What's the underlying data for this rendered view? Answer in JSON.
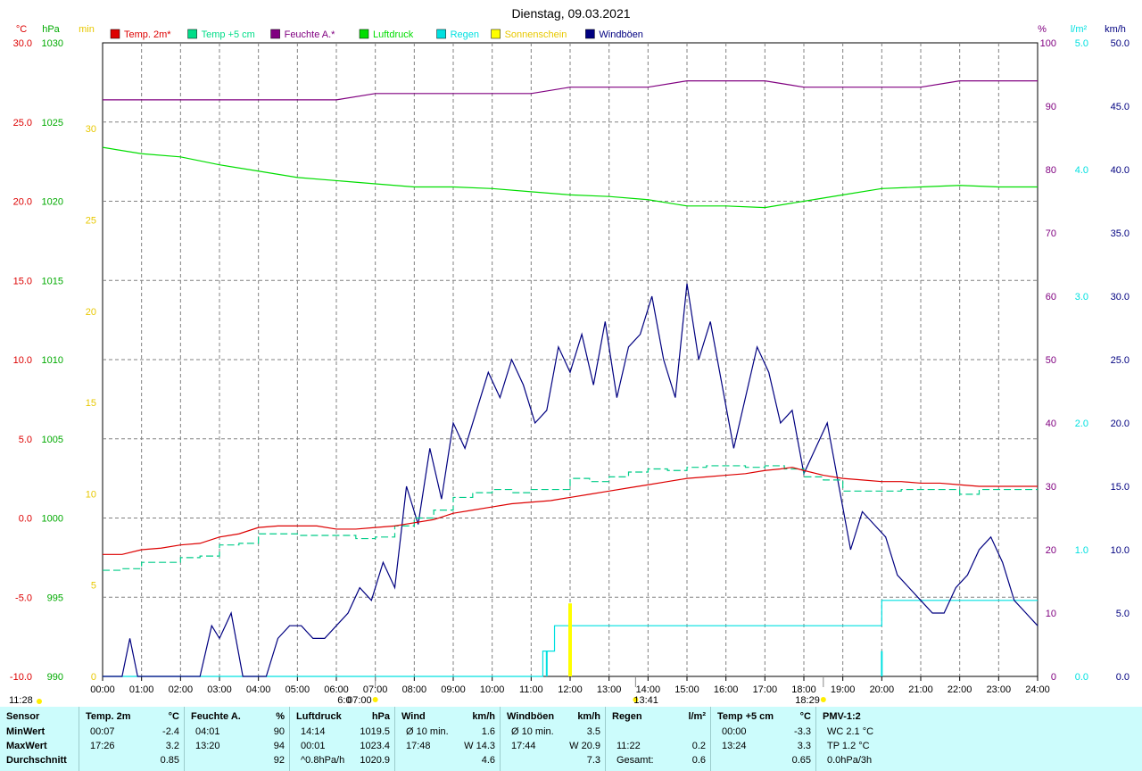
{
  "title": "Dienstag, 09.03.2021",
  "colors": {
    "temp2m": "#dd0000",
    "temp5cm": "#00cc88",
    "humidity": "#800080",
    "pressure": "#00dd00",
    "rain": "#00e0e0",
    "sunshine": "#ffff00",
    "wind": "#000080",
    "grid": "#808080",
    "stats_bg": "#ccfcfc"
  },
  "legend": [
    {
      "label": "Temp. 2m*",
      "color": "#dd0000"
    },
    {
      "label": "Temp +5 cm",
      "color": "#00dd88"
    },
    {
      "label": "Feuchte A.*",
      "color": "#800080"
    },
    {
      "label": "Luftdruck",
      "color": "#00dd00"
    },
    {
      "label": "Regen",
      "color": "#00e0e0"
    },
    {
      "label": "Sonnenschein",
      "color": "#ffff00"
    },
    {
      "label": "Windböen",
      "color": "#000080"
    }
  ],
  "axis_units": {
    "temp": "°C",
    "pressure": "hPa",
    "sun": "min",
    "humidity": "%",
    "rain": "l/m²",
    "wind": "km/h"
  },
  "chart_data": {
    "type": "line",
    "title": "Dienstag, 09.03.2021",
    "x_ticks": [
      "00:00",
      "01:00",
      "02:00",
      "03:00",
      "04:00",
      "05:00",
      "06:00",
      "07:00",
      "08:00",
      "09:00",
      "10:00",
      "11:00",
      "12:00",
      "13:00",
      "14:00",
      "15:00",
      "16:00",
      "17:00",
      "18:00",
      "19:00",
      "20:00",
      "21:00",
      "22:00",
      "23:00",
      "24:00"
    ],
    "axes": {
      "temp": {
        "label": "°C",
        "range": [
          -10,
          30
        ],
        "ticks": [
          "30.0",
          "25.0",
          "20.0",
          "15.0",
          "10.0",
          "5.0",
          "0.0",
          "-5.0",
          "-10.0"
        ]
      },
      "pressure": {
        "label": "hPa",
        "range": [
          990,
          1030
        ],
        "ticks": [
          "1030",
          "1025",
          "1020",
          "1015",
          "1010",
          "1005",
          "1000",
          "995",
          "990"
        ]
      },
      "sunshine": {
        "label": "min",
        "range": [
          0,
          30
        ],
        "ticks": [
          "30",
          "25",
          "20",
          "15",
          "10",
          "5",
          "0"
        ]
      },
      "humidity": {
        "label": "%",
        "range": [
          0,
          100
        ],
        "ticks": [
          "100",
          "90",
          "80",
          "70",
          "60",
          "50",
          "40",
          "30",
          "20",
          "10",
          "0"
        ]
      },
      "rain": {
        "label": "l/m²",
        "range": [
          0,
          5
        ],
        "ticks": [
          "5.0",
          "4.0",
          "3.0",
          "2.0",
          "1.0",
          "0.0"
        ]
      },
      "wind": {
        "label": "km/h",
        "range": [
          0,
          50
        ],
        "ticks": [
          "50.0",
          "45.0",
          "40.0",
          "35.0",
          "30.0",
          "25.0",
          "20.0",
          "15.0",
          "10.0",
          "5.0",
          "0.0"
        ]
      }
    },
    "series": [
      {
        "name": "Temp. 2m*",
        "axis": "temp",
        "x": [
          0,
          0.5,
          1,
          1.5,
          2,
          2.5,
          3,
          3.5,
          4,
          4.5,
          5,
          5.5,
          6,
          6.5,
          7,
          7.5,
          8,
          8.5,
          9,
          9.5,
          10,
          10.5,
          11,
          11.5,
          12,
          12.5,
          13,
          13.5,
          14,
          14.5,
          15,
          15.5,
          16,
          16.5,
          17,
          17.4,
          17.7,
          18,
          18.5,
          19,
          19.5,
          20,
          20.5,
          21,
          21.5,
          22,
          22.5,
          23,
          23.5,
          24
        ],
        "y": [
          -2.3,
          -2.3,
          -2.0,
          -1.9,
          -1.7,
          -1.6,
          -1.2,
          -1.0,
          -0.6,
          -0.5,
          -0.5,
          -0.5,
          -0.7,
          -0.7,
          -0.6,
          -0.5,
          -0.3,
          -0.1,
          0.3,
          0.5,
          0.7,
          0.9,
          1.0,
          1.1,
          1.3,
          1.5,
          1.7,
          1.9,
          2.1,
          2.3,
          2.5,
          2.6,
          2.7,
          2.8,
          3.0,
          3.1,
          3.2,
          3.0,
          2.7,
          2.5,
          2.4,
          2.3,
          2.3,
          2.2,
          2.2,
          2.1,
          2.0,
          2.0,
          2.0,
          2.0
        ]
      },
      {
        "name": "Temp +5 cm",
        "axis": "temp",
        "x": [
          0,
          0.5,
          1,
          1.5,
          2,
          2.5,
          3,
          3.5,
          4,
          4.5,
          5,
          5.5,
          6,
          6.5,
          7,
          7.5,
          8,
          8.5,
          9,
          9.5,
          10,
          10.5,
          11,
          11.5,
          12,
          12.5,
          13,
          13.5,
          14,
          14.5,
          15,
          15.5,
          16,
          16.5,
          17,
          17.5,
          18,
          18.5,
          19,
          19.5,
          20,
          20.5,
          21,
          21.5,
          22,
          22.5,
          23,
          23.5,
          24
        ],
        "y": [
          -3.3,
          -3.2,
          -2.8,
          -2.8,
          -2.5,
          -2.4,
          -1.7,
          -1.6,
          -1.0,
          -1.0,
          -1.1,
          -1.1,
          -1.1,
          -1.3,
          -1.2,
          -0.5,
          0.0,
          0.5,
          1.3,
          1.6,
          1.8,
          1.6,
          1.8,
          1.8,
          2.5,
          2.3,
          2.6,
          2.9,
          3.1,
          3.0,
          3.2,
          3.3,
          3.3,
          3.2,
          3.3,
          3.1,
          2.6,
          2.4,
          1.7,
          1.7,
          1.7,
          1.8,
          1.8,
          1.8,
          1.5,
          1.8,
          1.8,
          1.8,
          1.8
        ]
      },
      {
        "name": "Feuchte A.*",
        "axis": "humidity",
        "x": [
          0,
          1,
          2,
          3,
          4,
          5,
          6,
          7,
          8,
          9,
          10,
          11,
          12,
          13,
          14,
          15,
          16,
          17,
          18,
          19,
          20,
          21,
          22,
          23,
          24
        ],
        "y": [
          91,
          91,
          91,
          91,
          91,
          91,
          91,
          92,
          92,
          92,
          92,
          92,
          93,
          93,
          93,
          94,
          94,
          94,
          93,
          93,
          93,
          93,
          94,
          94,
          94
        ]
      },
      {
        "name": "Luftdruck",
        "axis": "pressure",
        "x": [
          0,
          1,
          2,
          3,
          4,
          5,
          6,
          7,
          8,
          9,
          10,
          11,
          12,
          13,
          14,
          15,
          16,
          17,
          18,
          19,
          20,
          21,
          22,
          23,
          24
        ],
        "y": [
          1023.4,
          1023.0,
          1022.8,
          1022.3,
          1021.9,
          1021.5,
          1021.3,
          1021.1,
          1020.9,
          1020.9,
          1020.8,
          1020.6,
          1020.4,
          1020.3,
          1020.1,
          1019.7,
          1019.7,
          1019.6,
          1020.0,
          1020.4,
          1020.8,
          1020.9,
          1021.0,
          1020.9,
          1020.9
        ]
      },
      {
        "name": "Regen",
        "axis": "rain",
        "x": [
          0,
          11.3,
          11.3,
          11.6,
          11.6,
          20,
          20,
          24
        ],
        "y": [
          0,
          0,
          0.2,
          0.2,
          0.4,
          0.4,
          0.6,
          0.6
        ]
      },
      {
        "name": "Sonnenschein",
        "axis": "sunshine",
        "x": [
          12.0
        ],
        "y": [
          4
        ]
      },
      {
        "name": "Windböen",
        "axis": "wind",
        "x": [
          0,
          0.5,
          0.7,
          0.9,
          1.2,
          2.5,
          2.8,
          3.0,
          3.3,
          3.6,
          3.9,
          4.2,
          4.5,
          4.8,
          5.1,
          5.4,
          5.7,
          6.0,
          6.3,
          6.6,
          6.9,
          7.2,
          7.5,
          7.8,
          8.1,
          8.4,
          8.7,
          9.0,
          9.3,
          9.6,
          9.9,
          10.2,
          10.5,
          10.8,
          11.1,
          11.4,
          11.7,
          12.0,
          12.3,
          12.6,
          12.9,
          13.2,
          13.5,
          13.8,
          14.1,
          14.4,
          14.7,
          15.0,
          15.3,
          15.6,
          15.9,
          16.2,
          16.5,
          16.8,
          17.1,
          17.4,
          17.7,
          18.0,
          18.3,
          18.6,
          18.9,
          19.2,
          19.5,
          19.8,
          20.1,
          20.4,
          20.7,
          21.0,
          21.3,
          21.6,
          21.9,
          22.2,
          22.5,
          22.8,
          23.1,
          23.4,
          23.7,
          24
        ],
        "y": [
          0,
          0,
          3,
          0,
          0,
          0,
          4,
          3,
          5,
          0,
          0,
          0,
          3,
          4,
          4,
          3,
          3,
          4,
          5,
          7,
          6,
          9,
          7,
          15,
          12,
          18,
          14,
          20,
          18,
          21,
          24,
          22,
          25,
          23,
          20,
          21,
          26,
          24,
          27,
          23,
          28,
          22,
          26,
          27,
          30,
          25,
          22,
          31,
          25,
          28,
          23,
          18,
          22,
          26,
          24,
          20,
          21,
          16,
          18,
          20,
          15,
          10,
          13,
          12,
          11,
          8,
          7,
          6,
          5,
          5,
          7,
          8,
          10,
          11,
          9,
          6,
          5,
          4
        ]
      }
    ]
  },
  "time_markers": {
    "sunrise": "07:00",
    "sunset": "18:29",
    "max_temp_time": "13:41",
    "left_label": "11:28",
    "dawn_label": "6:0"
  },
  "stats": {
    "columns": [
      {
        "header": "Sensor",
        "unit": "",
        "rows": [
          {
            "a": "MinWert",
            "b": ""
          },
          {
            "a": "MaxWert",
            "b": ""
          },
          {
            "a": "Durchschnitt",
            "b": ""
          }
        ]
      },
      {
        "header": "Temp. 2m",
        "unit": "°C",
        "rows": [
          {
            "a": "00:07",
            "b": "-2.4"
          },
          {
            "a": "17:26",
            "b": "3.2"
          },
          {
            "a": "",
            "b": "0.85"
          }
        ]
      },
      {
        "header": "Feuchte A.",
        "unit": "%",
        "rows": [
          {
            "a": "04:01",
            "b": "90"
          },
          {
            "a": "13:20",
            "b": "94"
          },
          {
            "a": "",
            "b": "92"
          }
        ]
      },
      {
        "header": "Luftdruck",
        "unit": "hPa",
        "rows": [
          {
            "a": "14:14",
            "b": "1019.5"
          },
          {
            "a": "00:01",
            "b": "1023.4"
          },
          {
            "a": "^0.8hPa/h",
            "b": "1020.9"
          }
        ]
      },
      {
        "header": "Wind",
        "unit": "km/h",
        "rows": [
          {
            "a": "Ø 10 min.",
            "b": "1.6"
          },
          {
            "a": "17:48",
            "b": "W 14.3"
          },
          {
            "a": "",
            "b": "4.6"
          }
        ]
      },
      {
        "header": "Windböen",
        "unit": "km/h",
        "rows": [
          {
            "a": "Ø 10 min.",
            "b": "3.5"
          },
          {
            "a": "17:44",
            "b": "W 20.9"
          },
          {
            "a": "",
            "b": "7.3"
          }
        ]
      },
      {
        "header": "Regen",
        "unit": "l/m²",
        "rows": [
          {
            "a": "",
            "b": ""
          },
          {
            "a": "11:22",
            "b": "0.2"
          },
          {
            "a": "Gesamt:",
            "b": "0.6"
          }
        ]
      },
      {
        "header": "Temp +5 cm",
        "unit": "°C",
        "rows": [
          {
            "a": "00:00",
            "b": "-3.3"
          },
          {
            "a": "13:24",
            "b": "3.3"
          },
          {
            "a": "",
            "b": "0.65"
          }
        ]
      },
      {
        "header": "PMV-1:2",
        "unit": "",
        "rows": [
          {
            "a": "WC 2.1 °C",
            "b": ""
          },
          {
            "a": "TP 1.2 °C",
            "b": ""
          },
          {
            "a": "0.0hPa/3h",
            "b": ""
          }
        ]
      }
    ]
  }
}
